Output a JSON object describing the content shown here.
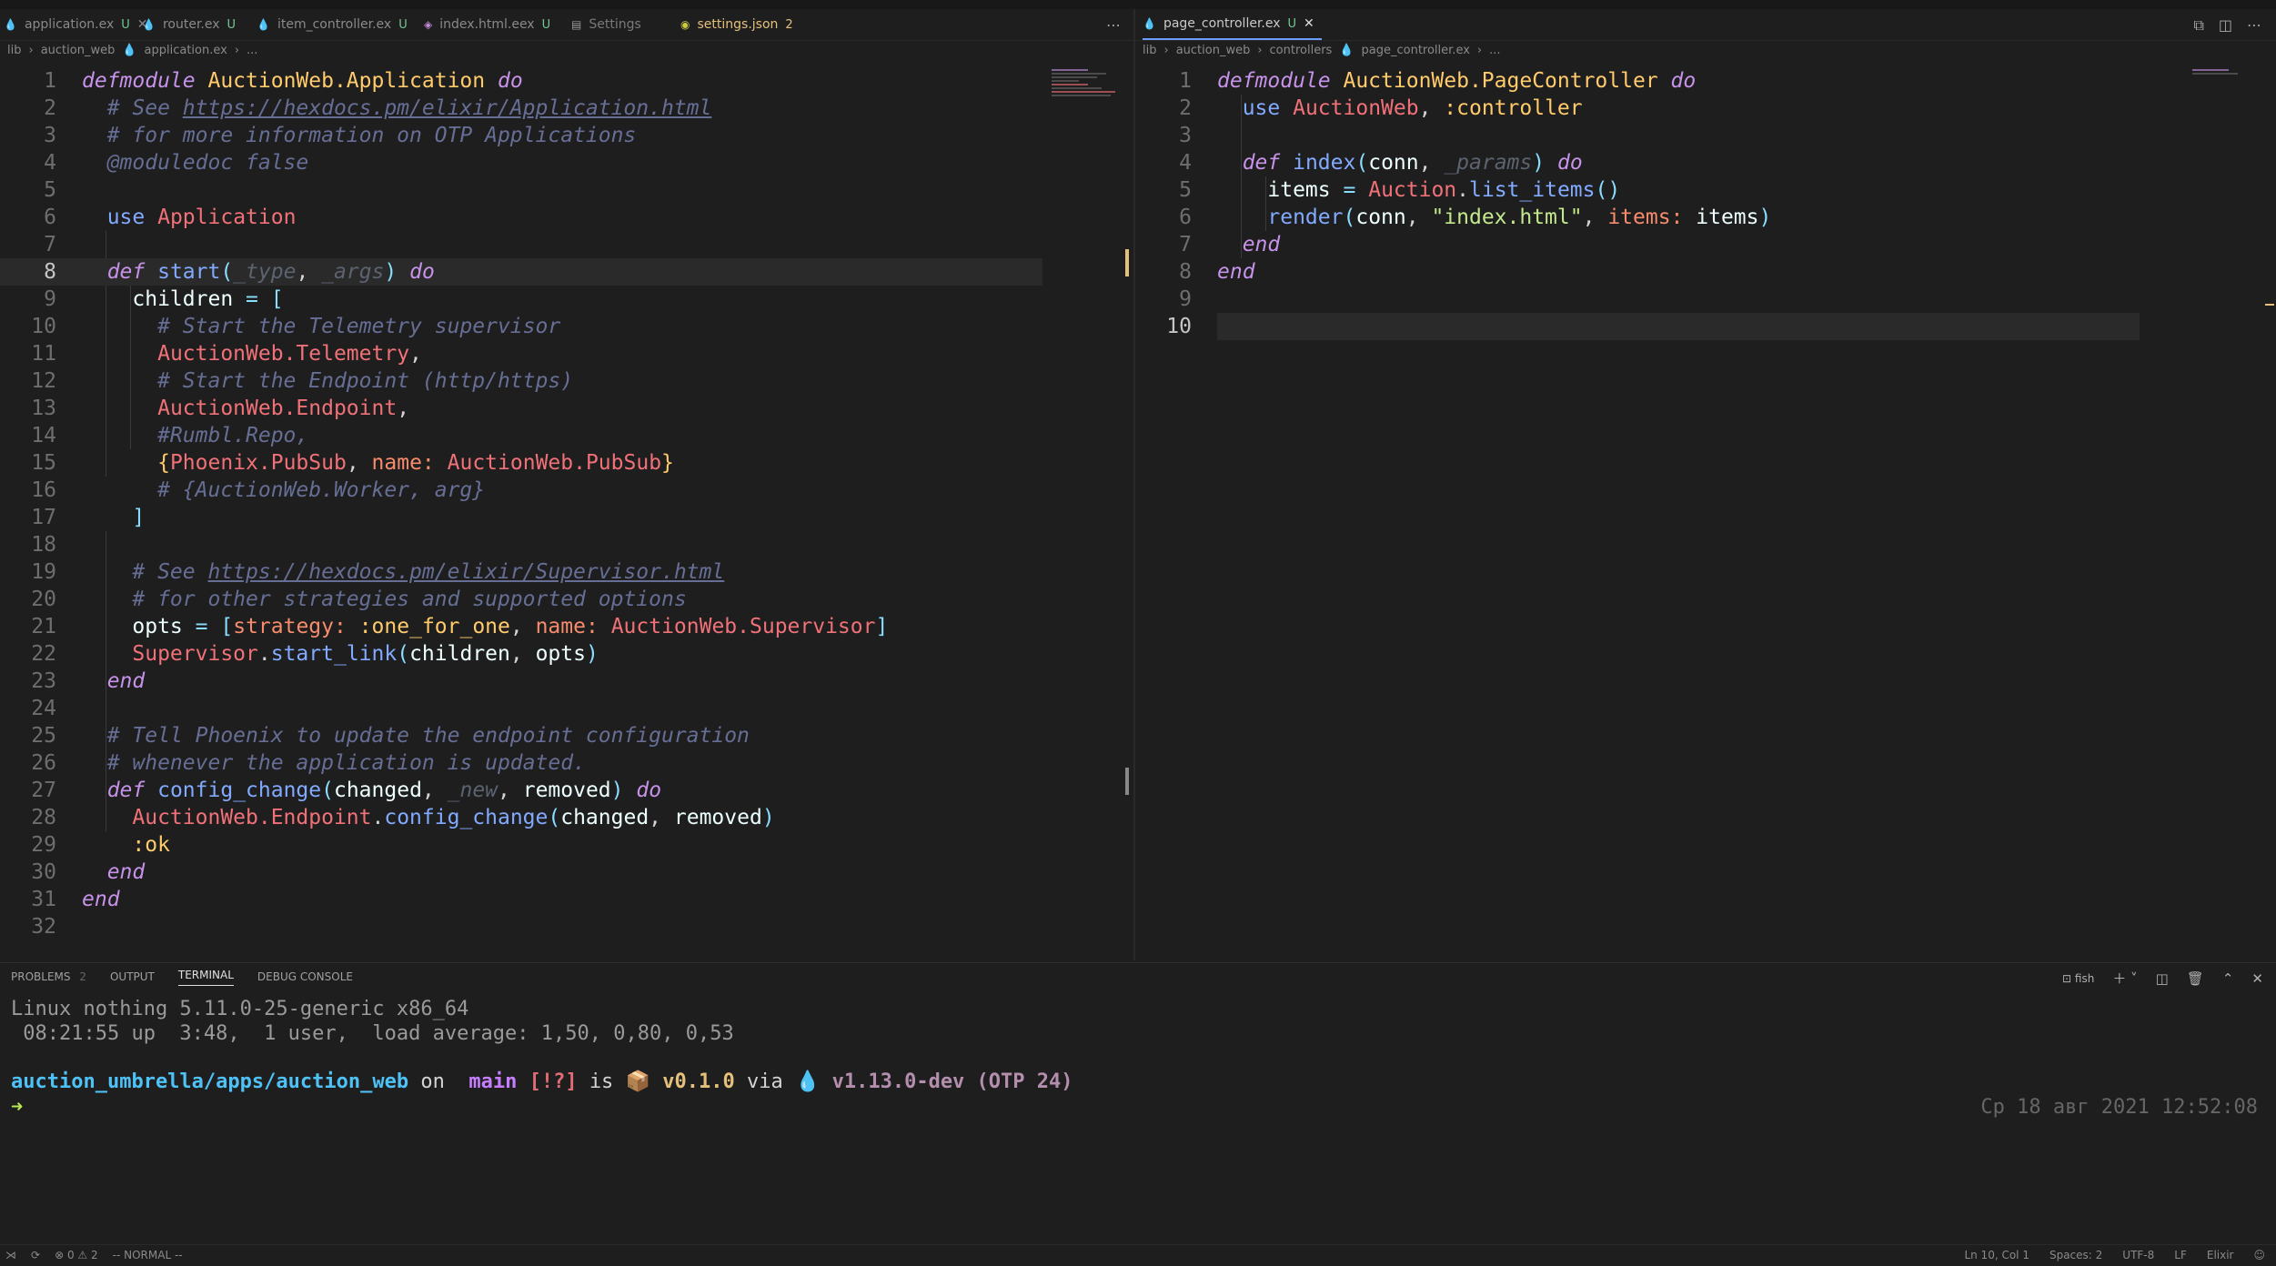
{
  "editor_left": {
    "tabs": [
      {
        "icon": "elixir-icon",
        "label": "application.ex",
        "status": "U",
        "active": false
      },
      {
        "icon": "elixir-icon",
        "label": "router.ex",
        "status": "U",
        "active": false
      },
      {
        "icon": "elixir-icon",
        "label": "item_controller.ex",
        "status": "U",
        "active": false
      },
      {
        "icon": "html-icon",
        "label": "index.html.eex",
        "status": "U",
        "active": false
      },
      {
        "icon": "settings-icon",
        "label": "Settings",
        "status": "",
        "active": false
      },
      {
        "icon": "json-icon",
        "label": "settings.json",
        "status": "2",
        "active": false
      }
    ],
    "breadcrumb": [
      "lib",
      "auction_web",
      "application.ex",
      "..."
    ],
    "line_numbers": [
      "1",
      "2",
      "3",
      "4",
      "5",
      "6",
      "7",
      "8",
      "9",
      "10",
      "11",
      "12",
      "13",
      "14",
      "15",
      "16",
      "17",
      "18",
      "19",
      "20",
      "21",
      "22",
      "23",
      "24",
      "25",
      "26",
      "27",
      "28",
      "29",
      "30",
      "31",
      "32"
    ],
    "code": [
      "defmodule AuctionWeb.Application do",
      "  # See https://hexdocs.pm/elixir/Application.html",
      "  # for more information on OTP Applications",
      "  @moduledoc false",
      "",
      "  use Application",
      "",
      "  def start(_type, _args) do",
      "    children = [",
      "      # Start the Telemetry supervisor",
      "      AuctionWeb.Telemetry,",
      "      # Start the Endpoint (http/https)",
      "      AuctionWeb.Endpoint,",
      "      #Rumbl.Repo,",
      "      {Phoenix.PubSub, name: AuctionWeb.PubSub}",
      "      # {AuctionWeb.Worker, arg}",
      "    ]",
      "",
      "    # See https://hexdocs.pm/elixir/Supervisor.html",
      "    # for other strategies and supported options",
      "    opts = [strategy: :one_for_one, name: AuctionWeb.Supervisor]",
      "    Supervisor.start_link(children, opts)",
      "  end",
      "",
      "  # Tell Phoenix to update the endpoint configuration",
      "  # whenever the application is updated.",
      "  def config_change(changed, _new, removed) do",
      "    AuctionWeb.Endpoint.config_change(changed, removed)",
      "    :ok",
      "  end",
      "end",
      ""
    ],
    "active_line": "8"
  },
  "editor_right": {
    "tabs": [
      {
        "icon": "elixir-icon",
        "label": "page_controller.ex",
        "status": "U",
        "active": true
      }
    ],
    "breadcrumb": [
      "lib",
      "auction_web",
      "controllers",
      "page_controller.ex",
      "..."
    ],
    "line_numbers": [
      "1",
      "2",
      "3",
      "4",
      "5",
      "6",
      "7",
      "8",
      "9",
      "10"
    ],
    "code": [
      "defmodule AuctionWeb.PageController do",
      "  use AuctionWeb, :controller",
      "",
      "  def index(conn, _params) do",
      "    items = Auction.list_items()",
      "    render(conn, \"index.html\", items: items)",
      "  end",
      "end",
      "",
      ""
    ],
    "active_line": "10"
  },
  "panel": {
    "tabs": [
      "PROBLEMS",
      "OUTPUT",
      "TERMINAL",
      "DEBUG CONSOLE"
    ],
    "problems_count": "2",
    "active_tab": "TERMINAL",
    "shell": "fish",
    "terminal": {
      "line1": "Linux nothing 5.11.0-25-generic x86_64",
      "line2": " 08:21:55 up  3:48,  1 user,  load average: 1,50, 0,80, 0,53",
      "prompt_path": "auction_umbrella/apps/auction_web",
      "on": "on",
      "branch_icon": "",
      "branch": "main",
      "git_status": "[!?]",
      "is": "is",
      "pkg_icon": "📦",
      "pkg_version": "v0.1.0",
      "via": "via",
      "elixir_icon": "💧",
      "elixir_version": "v1.13.0-dev (OTP 24)",
      "prompt_arrow": "➜",
      "right_prompt": "Ср 18 авг 2021 12:52:08"
    }
  },
  "status_bar": {
    "errors": "0",
    "warnings": "2",
    "mode": "-- NORMAL --",
    "position": "Ln 10, Col 1",
    "spaces": "Spaces: 2",
    "encoding": "UTF-8",
    "eol": "LF",
    "language": "Elixir"
  },
  "colors": {
    "background": "#1e1e1e",
    "keyword": "#c792ea",
    "module": "#f07178",
    "comment": "#676e95",
    "function": "#82aaff",
    "atom": "#ffcb6b",
    "string": "#c3e88d",
    "terminal_path": "#4ec2f7",
    "accent_tab": "#6b9eff"
  }
}
